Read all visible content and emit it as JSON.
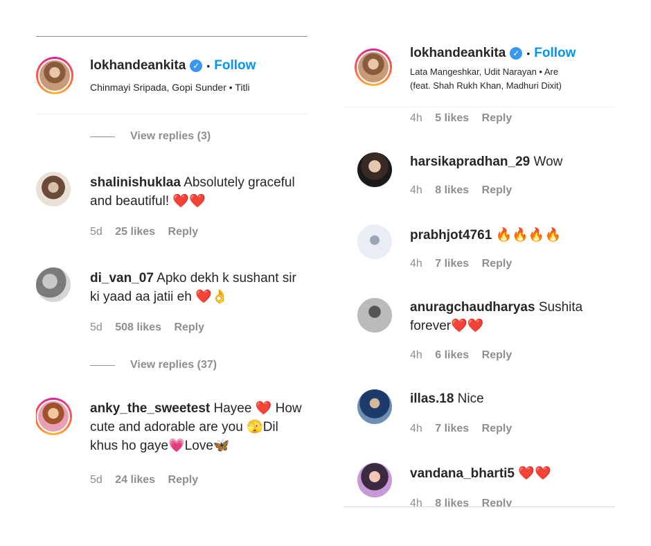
{
  "left": {
    "header": {
      "username": "lokhandeankita",
      "bullet": "•",
      "follow": "Follow",
      "audio": "Chinmayi Sripada, Gopi Sunder • Titli"
    },
    "view_replies_1": "View replies (3)",
    "comments": [
      {
        "username": "shalinishuklaa",
        "text": "Absolutely graceful and beautiful! ❤️❤️",
        "time": "5d",
        "likes": "25 likes",
        "reply": "Reply"
      },
      {
        "username": "di_van_07",
        "text": "Apko dekh k sushant sir ki yaad aa jatii eh ❤️👌",
        "time": "5d",
        "likes": "508 likes",
        "reply": "Reply"
      },
      {
        "username": "anky_the_sweetest",
        "text": "Hayee ❤️ How cute and adorable are you 🫣Dil khus ho gaye💗Love🦋",
        "time": "5d",
        "likes": "24 likes",
        "reply": "Reply"
      }
    ],
    "view_replies_2": "View replies (37)"
  },
  "right": {
    "header": {
      "username": "lokhandeankita",
      "bullet": "•",
      "follow": "Follow",
      "audio_line1": "Lata Mangeshkar, Udit Narayan • Are",
      "audio_line2": "(feat. Shah Rukh Khan, Madhuri Dixit)"
    },
    "top_meta": {
      "time": "4h",
      "likes": "5 likes",
      "reply": "Reply"
    },
    "comments": [
      {
        "username": "harsikapradhan_29",
        "text": "Wow",
        "time": "4h",
        "likes": "8 likes",
        "reply": "Reply"
      },
      {
        "username": "prabhjot4761",
        "text": "🔥🔥🔥🔥",
        "time": "4h",
        "likes": "7 likes",
        "reply": "Reply"
      },
      {
        "username": "anuragchaudharyas",
        "text": "Sushita forever❤️❤️",
        "time": "4h",
        "likes": "6 likes",
        "reply": "Reply"
      },
      {
        "username": "illas.18",
        "text": "Nice",
        "time": "4h",
        "likes": "7 likes",
        "reply": "Reply"
      },
      {
        "username": "vandana_bharti5",
        "text": "❤️❤️",
        "time": "4h",
        "likes": "8 likes",
        "reply": "Reply"
      }
    ]
  },
  "colors": {
    "follow": "#0095f6",
    "meta": "#8e8e8e",
    "text": "#262626",
    "verified": "#3897f0"
  },
  "icons": {
    "verified": "verified-badge-icon"
  }
}
